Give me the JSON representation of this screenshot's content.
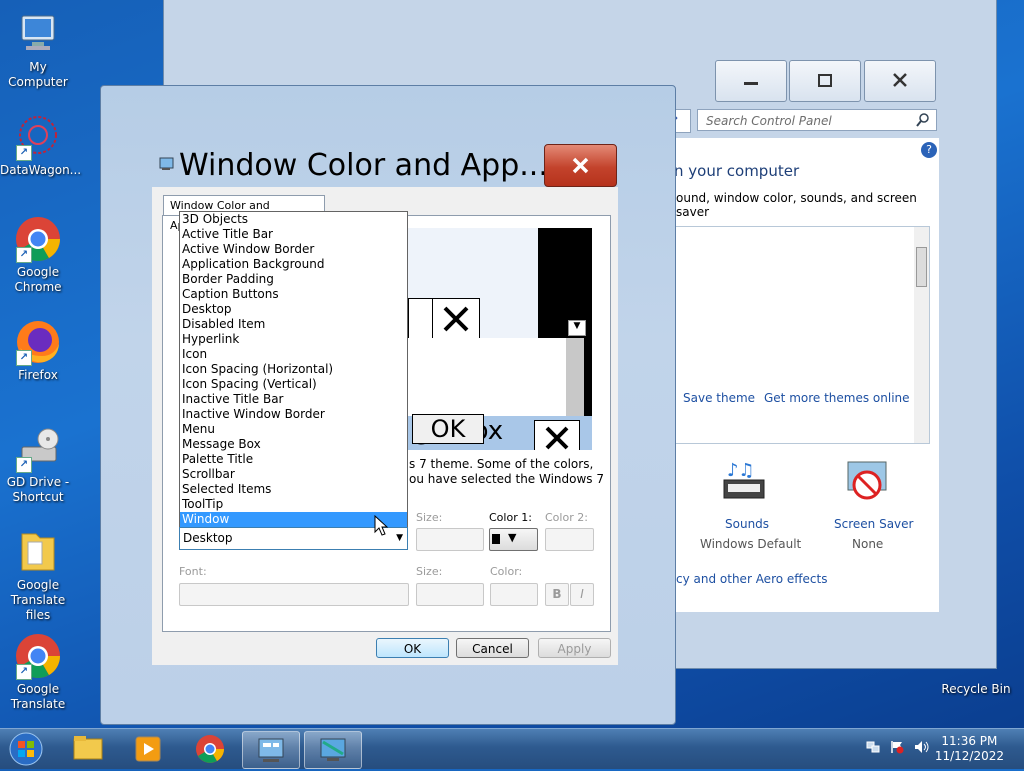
{
  "desktop": {
    "icons": [
      {
        "label": "My Computer"
      },
      {
        "label": "DataWagon..."
      },
      {
        "label": "Google Chrome"
      },
      {
        "label": "Firefox"
      },
      {
        "label": "GD Drive - Shortcut"
      },
      {
        "label": "Google Translate files"
      },
      {
        "label": "Google Translate"
      },
      {
        "label": "Recycle Bin"
      }
    ]
  },
  "control_panel": {
    "search_placeholder": "Search Control Panel",
    "heading": "n your computer",
    "subtext": "ound, window color, sounds, and screen saver",
    "save_theme": "Save theme",
    "get_more_themes": "Get more themes online",
    "sounds": {
      "label": "Sounds",
      "value": "Windows Default"
    },
    "screen_saver": {
      "label": "Screen Saver",
      "value": "None"
    },
    "aero_link": "cy and other Aero effects",
    "help": "?"
  },
  "dialog": {
    "title": "Window Color and App...",
    "tab": "Window Color and Appearance",
    "preview": {
      "ok": "OK",
      "msg": "ge Box"
    },
    "info_line1": "s 7 theme.  Some of the colors,",
    "info_line2": "ou have selected the Windows 7",
    "item_label_size": "Size:",
    "color1": "Color 1:",
    "color2": "Color 2:",
    "font": "Font:",
    "font_size": "Size:",
    "font_color": "Color:",
    "bold": "B",
    "italic": "I",
    "ok": "OK",
    "cancel": "Cancel",
    "apply": "Apply",
    "selected_item": "Desktop",
    "items": [
      "3D Objects",
      "Active Title Bar",
      "Active Window Border",
      "Application Background",
      "Border Padding",
      "Caption Buttons",
      "Desktop",
      "Disabled Item",
      "Hyperlink",
      "Icon",
      "Icon Spacing (Horizontal)",
      "Icon Spacing (Vertical)",
      "Inactive Title Bar",
      "Inactive Window Border",
      "Menu",
      "Message Box",
      "Palette Title",
      "Scrollbar",
      "Selected Items",
      "ToolTip",
      "Window"
    ],
    "highlighted": "Window"
  },
  "taskbar": {
    "time": "11:36 PM",
    "date": "11/12/2022"
  }
}
